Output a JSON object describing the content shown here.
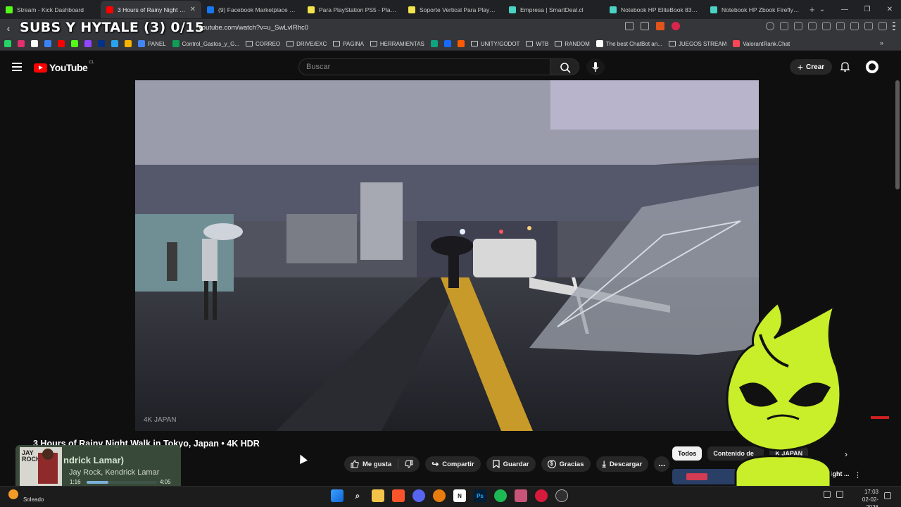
{
  "browser": {
    "tabs": [
      {
        "label": "Stream - Kick Dashboard",
        "color": "#53fc18"
      },
      {
        "label": "3 Hours of Rainy Night W...",
        "color": "#ff0000",
        "active": true
      },
      {
        "label": "(9) Facebook Marketplace | Fa...",
        "color": "#1877f2"
      },
      {
        "label": "Para PlayStation PS5 - PlaySta...",
        "color": "#f2e44b"
      },
      {
        "label": "Soporte Vertical Para Playstatio...",
        "color": "#f2e44b"
      },
      {
        "label": "Empresa | SmartDeal.cl",
        "color": "#4ad2c4"
      },
      {
        "label": "Notebook HP EliteBook 830 G...",
        "color": "#4ad2c4"
      },
      {
        "label": "Notebook HP Zbook Firefly 14...",
        "color": "#4ad2c4"
      }
    ],
    "url": "youtube.com/watch?v=u_SwLvIRhc0",
    "overlay_text": "SUBS Y HYTALE (3) 0/15",
    "bookmarks": [
      {
        "label": "",
        "type": "icon",
        "color": "#25d366"
      },
      {
        "label": "",
        "type": "icon",
        "color": "#e1306c"
      },
      {
        "label": "",
        "type": "icon",
        "color": "#ffffff"
      },
      {
        "label": "",
        "type": "icon",
        "color": "#3b82f6"
      },
      {
        "label": "",
        "type": "icon",
        "color": "#ff0000"
      },
      {
        "label": "",
        "type": "icon",
        "color": "#53fc18"
      },
      {
        "label": "",
        "type": "icon",
        "color": "#9146ff"
      },
      {
        "label": "",
        "type": "icon",
        "color": "#003087"
      },
      {
        "label": "",
        "type": "icon",
        "color": "#2aa3ef"
      },
      {
        "label": "",
        "type": "icon",
        "color": "#f7b500"
      },
      {
        "label": "PANEL",
        "type": "icon",
        "color": "#4285f4"
      },
      {
        "label": "Control_Gastos_y_G...",
        "type": "icon",
        "color": "#0f9d58"
      },
      {
        "label": "CORREO",
        "type": "folder"
      },
      {
        "label": "DRIVE/EXC",
        "type": "folder"
      },
      {
        "label": "PAGINA",
        "type": "folder"
      },
      {
        "label": "HERRAMIENTAS",
        "type": "folder"
      },
      {
        "label": "",
        "type": "icon",
        "color": "#10a37f"
      },
      {
        "label": "",
        "type": "icon",
        "color": "#1769ff"
      },
      {
        "label": "",
        "type": "icon",
        "color": "#ff5a00"
      },
      {
        "label": "UNITY/GODOT",
        "type": "folder"
      },
      {
        "label": "WTB",
        "type": "folder"
      },
      {
        "label": "RANDOM",
        "type": "folder"
      },
      {
        "label": "The best ChatBot an...",
        "type": "icon",
        "color": "#ffffff"
      },
      {
        "label": "JUEGOS STREAM",
        "type": "folder"
      },
      {
        "label": "ValorantRank.Chat",
        "type": "icon",
        "color": "#ff4655"
      }
    ]
  },
  "youtube": {
    "logo_text": "YouTube",
    "country": "CL",
    "search_placeholder": "Buscar",
    "create_label": "Crear",
    "video_title": "3 Hours of Rainy Night Walk in Tokyo, Japan • 4K HDR",
    "actions": {
      "like": "Me gusta",
      "share": "Compartir",
      "save": "Guardar",
      "thanks": "Gracias",
      "download": "Descargar",
      "more": "..."
    },
    "chips": [
      "Todos",
      "Contenido de",
      "K JAPAN"
    ],
    "recommendation_title": "Snow Night ... 4K HDR",
    "video_watermark": "4K JAPAN"
  },
  "music": {
    "song": "ndrick Lamar)",
    "artist": "Jay Rock, Kendrick Lamar",
    "elapsed": "1:16",
    "duration": "4:05",
    "progress": 0.31,
    "album_text": "JAY ROCK"
  },
  "taskbar": {
    "weather": "Soleado",
    "time": "17:03",
    "date": "02-02-2026"
  }
}
